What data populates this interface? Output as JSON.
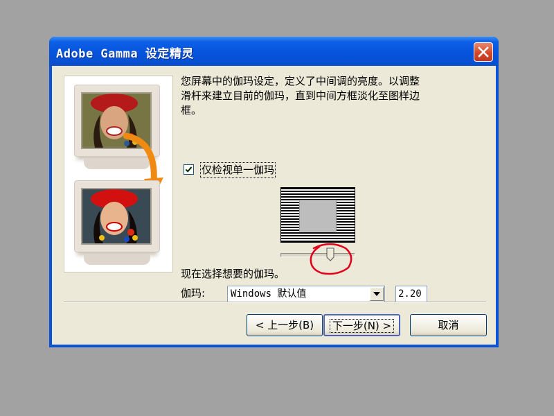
{
  "window": {
    "title": "Adobe Gamma 设定精灵"
  },
  "description": "您屏幕中的伽玛设定，定义了中间调的亮度。以调整滑杆来建立目前的伽玛，直到中间方框淡化至图样边框。",
  "checkbox": {
    "label": "仅检视单一伽玛",
    "checked": true
  },
  "gamma_slider": {
    "level": 0.72
  },
  "choose_label": "现在选择想要的伽玛。",
  "gamma": {
    "label": "伽玛:",
    "selected": "Windows 默认值",
    "value": "2.20"
  },
  "buttons": {
    "back": "< 上一步(B)",
    "next": "下一步(N) >",
    "cancel": "取消"
  },
  "icons": {
    "close": "close-icon",
    "arrow": "curved-arrow-icon",
    "dropdown": "chevron-down-icon",
    "check": "check-icon"
  },
  "colors": {
    "titlebar": "#0a52d6",
    "client": "#ece9d8",
    "close": "#d5462a",
    "annotation": "#e0001b",
    "arrow": "#f08a12"
  }
}
